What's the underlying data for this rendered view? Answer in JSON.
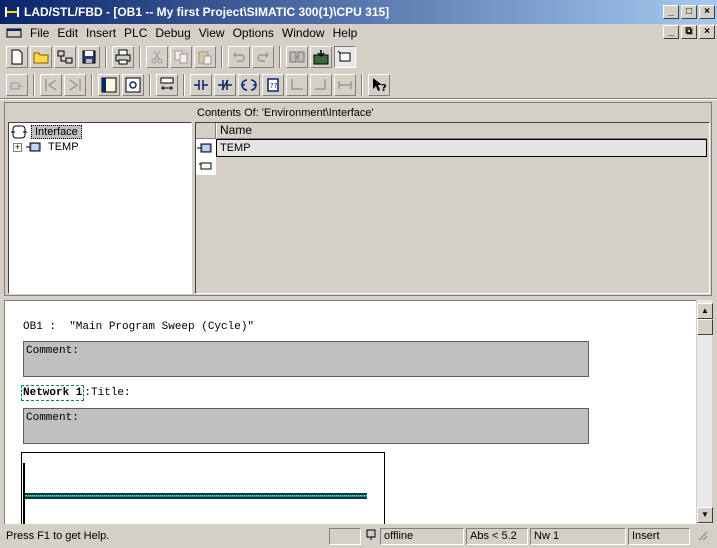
{
  "window": {
    "title": "LAD/STL/FBD  - [OB1 -- My first Project\\SIMATIC 300(1)\\CPU 315]",
    "minimize_label": "_",
    "maximize_label": "□",
    "close_label": "×"
  },
  "menu": {
    "items": [
      "File",
      "Edit",
      "Insert",
      "PLC",
      "Debug",
      "View",
      "Options",
      "Window",
      "Help"
    ],
    "restore_label": "⧉"
  },
  "toolbar1": [
    "new",
    "open",
    "accessible-nodes",
    "save",
    "print",
    "cut",
    "copy",
    "paste",
    "undo",
    "redo",
    "load",
    "download",
    "monitor"
  ],
  "toolbar2": [
    "show-hide-program-elements",
    "previous-network",
    "next-network",
    "overview",
    "details",
    "new-network",
    "normally-open-contact",
    "normally-closed-contact",
    "coil",
    "empty-box",
    "open-branch",
    "close-branch",
    "connection",
    "help-on-context"
  ],
  "tree": {
    "root_label": "Interface",
    "child_label": "TEMP",
    "expander_symbol": "+"
  },
  "contents": {
    "header": "Contents Of: 'Environment\\Interface'",
    "column_name": "Name",
    "rows": [
      "TEMP"
    ]
  },
  "editor": {
    "block_title": "OB1 :  \"Main Program Sweep (Cycle)\"",
    "block_comment_label": "Comment:",
    "network_label": "Network 1",
    "network_title": ":Title:",
    "network_comment_label": "Comment:"
  },
  "scrollbar": {
    "up_arrow": "▲",
    "down_arrow": "▼"
  },
  "status": {
    "help_text": "Press F1 to get Help.",
    "online_state": "offline",
    "abs_value": "Abs < 5.2",
    "network_value": "Nw 1",
    "insert_mode": "Insert"
  },
  "colors": {
    "titlebar_start": "#0a246a",
    "titlebar_end": "#a6caf0",
    "rung": "#2a8a8a",
    "comment_box": "#c0c0c0"
  }
}
